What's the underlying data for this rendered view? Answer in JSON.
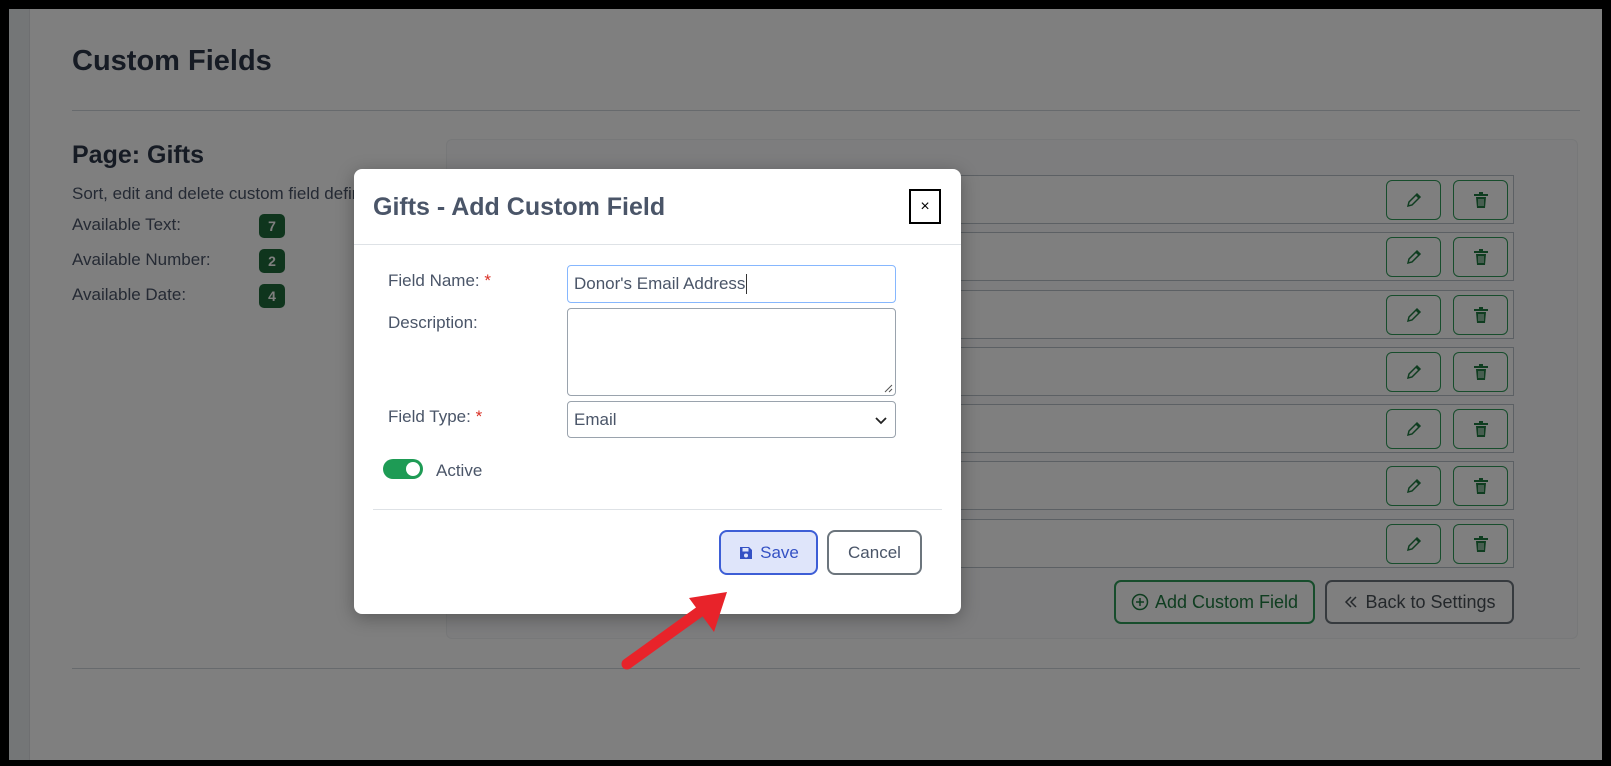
{
  "page": {
    "title": "Custom Fields",
    "section_title": "Page: Gifts",
    "section_desc": "Sort, edit and delete custom field definitions",
    "available": [
      {
        "label": "Available Text:",
        "count": "7"
      },
      {
        "label": "Available Number:",
        "count": "2"
      },
      {
        "label": "Available Date:",
        "count": "4"
      }
    ],
    "row_icons": {
      "edit": "pencil-icon",
      "delete": "trash-icon"
    },
    "buttons": {
      "add_label": "Add Custom Field",
      "back_label": "Back to Settings"
    }
  },
  "modal": {
    "title": "Gifts - Add Custom Field",
    "close_label": "×",
    "field_name_label": "Field Name:",
    "field_name_value": "Donor's Email Address",
    "description_label": "Description:",
    "description_value": "",
    "field_type_label": "Field Type:",
    "field_type_value": "Email",
    "required_marker": "*",
    "active_label": "Active",
    "active_on": true,
    "save_label": "Save",
    "cancel_label": "Cancel"
  },
  "colors": {
    "accent_green": "#2f9a58",
    "badge_green": "#1e6b3a",
    "save_blue": "#3d5ed6",
    "annotation_arrow": "#e8232a"
  }
}
